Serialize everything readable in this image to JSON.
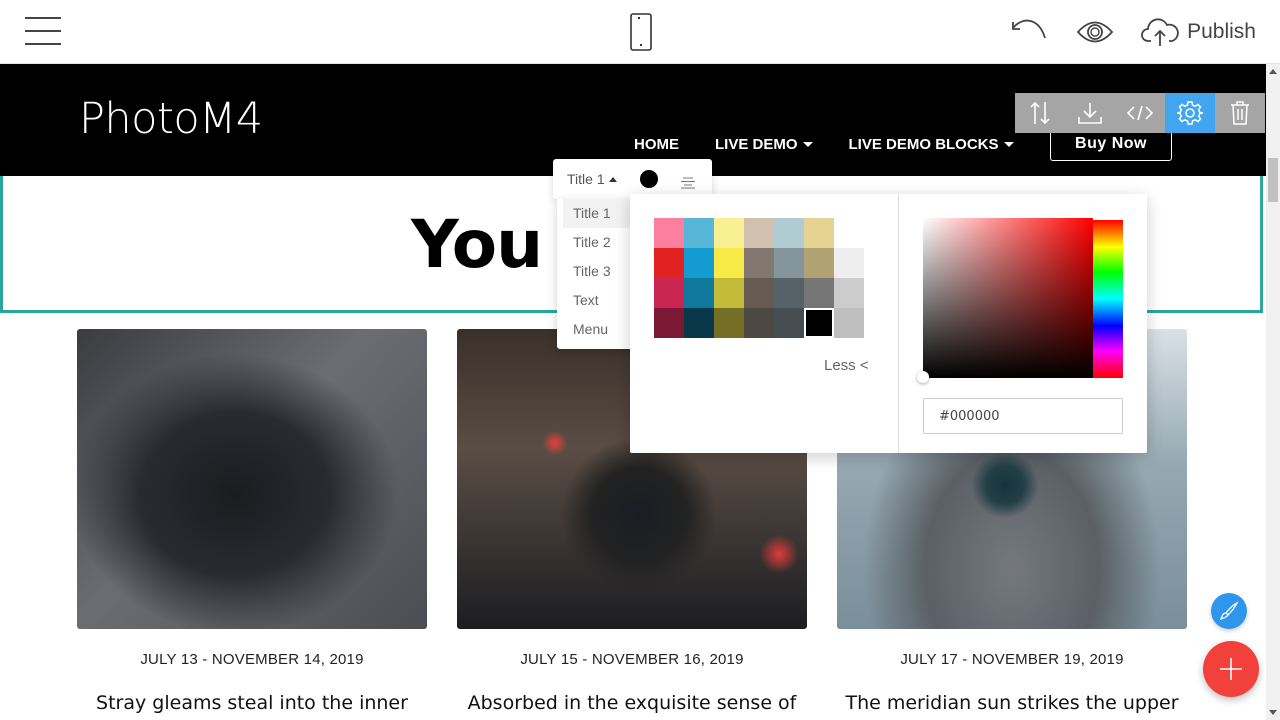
{
  "topbar": {
    "menu_icon": "hamburger-icon",
    "device_icon": "mobile-phone-icon",
    "undo_icon": "undo-icon",
    "preview_icon": "eye-icon",
    "publish_icon": "cloud-upload-icon",
    "publish_label": "Publish"
  },
  "site": {
    "brand": "PhotoM4",
    "nav": [
      {
        "label": "HOME",
        "dropdown": false
      },
      {
        "label": "LIVE DEMO",
        "dropdown": true
      },
      {
        "label": "LIVE DEMO BLOCKS",
        "dropdown": true
      }
    ],
    "cta": "Buy Now",
    "title": "You C",
    "cards": [
      {
        "date": "JULY 13 - NOVEMBER 14, 2019",
        "title": "Stray gleams steal into the inner",
        "image": "hands holding Canon DSLR camera"
      },
      {
        "date": "JULY 15 - NOVEMBER 16, 2019",
        "title": "Absorbed in the exquisite sense of",
        "image": "woman in beanie taking photo on city street"
      },
      {
        "date": "JULY 17 - NOVEMBER 19, 2019",
        "title": "The meridian sun strikes the upper",
        "image": "woman in knit sweater with camera in snow"
      }
    ]
  },
  "block_toolbar": {
    "items": [
      {
        "name": "move-block",
        "icon": "arrows-up-down-icon"
      },
      {
        "name": "save-block",
        "icon": "download-icon"
      },
      {
        "name": "edit-code",
        "icon": "code-icon"
      },
      {
        "name": "block-settings",
        "icon": "gear-icon",
        "active": true
      },
      {
        "name": "delete-block",
        "icon": "trash-icon"
      }
    ],
    "active_color": "#41a6ef"
  },
  "text_toolbar": {
    "style_value": "Title 1",
    "current_color": "#000000",
    "align_icon": "align-center-icon"
  },
  "style_menu": {
    "items": [
      "Title 1",
      "Title 2",
      "Title 3",
      "Text",
      "Menu"
    ],
    "selected": "Title 1"
  },
  "color_picker": {
    "swatches": [
      [
        "#fd7f9f",
        "#58b6d9",
        "#f8ef92",
        "#d1c0ae",
        "#b1cbd2",
        "#e4d393",
        null
      ],
      [
        "#e22220",
        "#149bd1",
        "#f7ea47",
        "#82786f",
        "#84959b",
        "#b0a273",
        "#eeeeee"
      ],
      [
        "#ca2652",
        "#10789a",
        "#c5bb3a",
        "#655b52",
        "#566267",
        "#767676",
        "#cccccc"
      ],
      [
        "#7c1834",
        "#0a384b",
        "#746f25",
        "#4e4843",
        "#454d50",
        "#000000",
        "#bfbfbf"
      ]
    ],
    "selected_swatch": "#000000",
    "less_label": "Less <",
    "hex_value": "#000000",
    "hue": "#ff0000"
  },
  "fabs": {
    "brush_icon": "paintbrush-icon",
    "add_icon": "plus-icon",
    "brush_color": "#2f96ed",
    "add_color": "#f2413a"
  },
  "accent_color": "#2aa79b"
}
